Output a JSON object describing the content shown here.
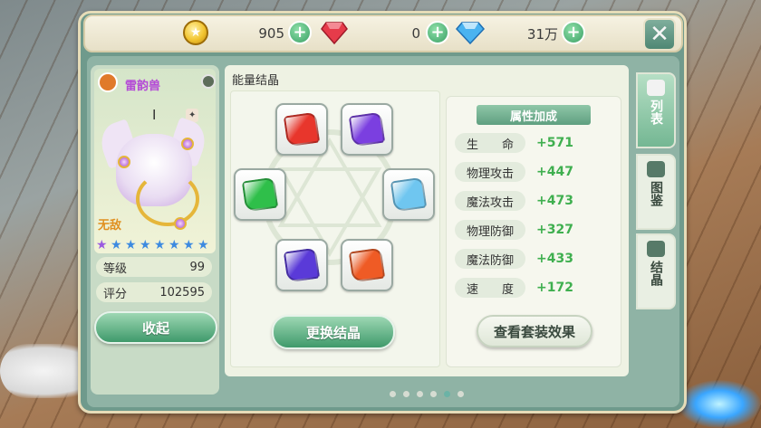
{
  "resources": {
    "gold": {
      "icon": "gold-coin-icon",
      "value": "905"
    },
    "ruby": {
      "icon": "red-gem-icon",
      "value": "0"
    },
    "diamond": {
      "icon": "blue-diamond-icon",
      "value": "31万"
    }
  },
  "pet": {
    "name": "雷韵兽",
    "rank": "I",
    "state": "无敌",
    "stars_purple": 1,
    "stars_total": 8,
    "level_label": "等级",
    "level_value": "99",
    "score_label": "评分",
    "score_value": "102595",
    "collapse_button": "收起"
  },
  "crystal_panel": {
    "title": "能量结晶",
    "crystals": [
      {
        "name": "red-crystal",
        "color": "#e8362c"
      },
      {
        "name": "purple-crystal",
        "color": "#7b3fe0"
      },
      {
        "name": "green-crystal",
        "color": "#2fbf4a"
      },
      {
        "name": "blue-crystal",
        "color": "#6fc6f0"
      },
      {
        "name": "violet-crystal",
        "color": "#5a3ad8"
      },
      {
        "name": "orange-crystal",
        "color": "#ef5b25"
      }
    ],
    "change_button": "更换结晶"
  },
  "attributes": {
    "header": "属性加成",
    "rows": [
      {
        "label": "生　　命",
        "value": "+571"
      },
      {
        "label": "物理攻击",
        "value": "+447"
      },
      {
        "label": "魔法攻击",
        "value": "+473"
      },
      {
        "label": "物理防御",
        "value": "+327"
      },
      {
        "label": "魔法防御",
        "value": "+433"
      },
      {
        "label": "速　　度",
        "value": "+172"
      }
    ],
    "set_effect_button": "查看套装效果"
  },
  "side_tabs": [
    {
      "label": "列表",
      "active": true
    },
    {
      "label": "图鉴",
      "active": false
    },
    {
      "label": "结晶",
      "active": false
    }
  ],
  "pager": {
    "count": 6,
    "active": 5
  }
}
